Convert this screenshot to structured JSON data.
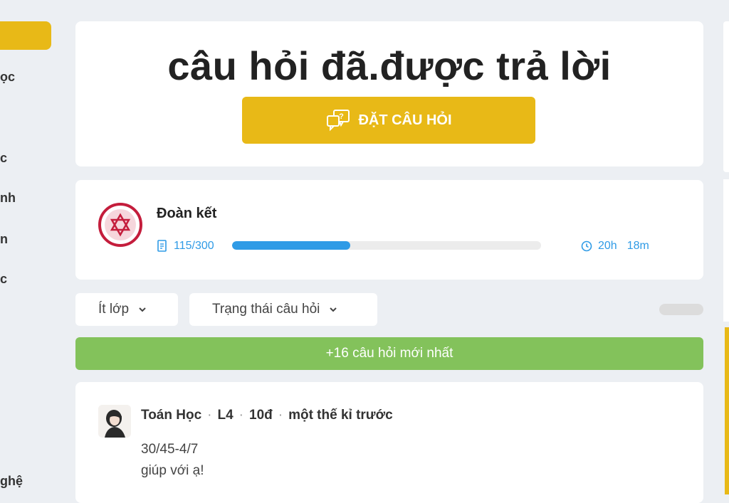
{
  "sidebar": {
    "items": [
      "ọc",
      "c",
      "nh",
      "n",
      "c",
      "ghệ"
    ]
  },
  "hero": {
    "title": "câu hỏi đã.được trả lời",
    "ask_button": "ĐẶT CÂU HỎI"
  },
  "team": {
    "name": "Đoàn kết",
    "progress_text": "115/300",
    "progress_fraction": 0.383,
    "timer_hours": "20h",
    "timer_minutes": "18m"
  },
  "filters": {
    "grade": "Ít lớp",
    "status": "Trạng thái câu hỏi"
  },
  "new_questions": "+16 câu hỏi mới nhất",
  "question": {
    "subject": "Toán Học",
    "level": "L4",
    "points": "10đ",
    "time": "một thế kỉ trước",
    "line1": "30/45-4/7",
    "line2": "giúp với ạ!"
  },
  "colors": {
    "accent": "#e8b917",
    "progress": "#2f9be6",
    "new_bar": "#83c25b",
    "badge": "#c41d3c"
  }
}
